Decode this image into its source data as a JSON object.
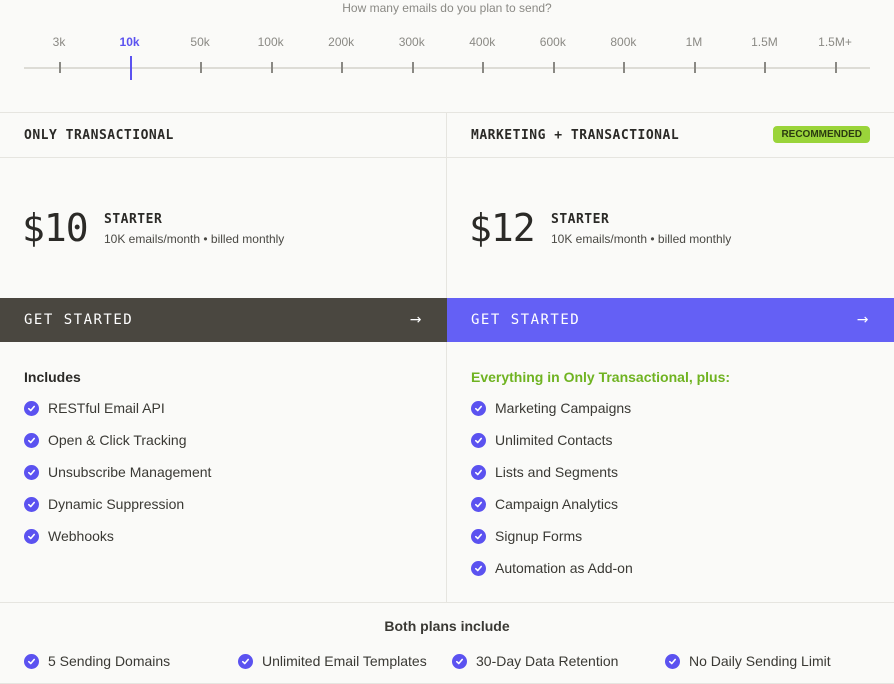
{
  "slider": {
    "question": "How many emails do you plan to send?",
    "ticks": [
      "3k",
      "10k",
      "50k",
      "100k",
      "200k",
      "300k",
      "400k",
      "600k",
      "800k",
      "1M",
      "1.5M",
      "1.5M+"
    ],
    "selected_index": 1,
    "accent": "#5b52f0"
  },
  "plans": {
    "left": {
      "title": "ONLY TRANSACTIONAL",
      "price": "$10",
      "tier": "STARTER",
      "billing": "10K emails/month • billed monthly",
      "cta": "GET STARTED",
      "features_heading": "Includes",
      "features": [
        "RESTful Email API",
        "Open & Click Tracking",
        "Unsubscribe Management",
        "Dynamic Suppression",
        "Webhooks"
      ],
      "cta_color": "#4a4740"
    },
    "right": {
      "title": "MARKETING + TRANSACTIONAL",
      "badge": "RECOMMENDED",
      "price": "$12",
      "tier": "STARTER",
      "billing": "10K emails/month • billed monthly",
      "cta": "GET STARTED",
      "features_heading": "Everything in Only Transactional, plus:",
      "features": [
        "Marketing Campaigns",
        "Unlimited Contacts",
        "Lists and Segments",
        "Campaign Analytics",
        "Signup Forms",
        "Automation as Add-on"
      ],
      "cta_color": "#6460f5",
      "badge_color": "#9ad43a"
    }
  },
  "both": {
    "title": "Both plans include",
    "items": [
      "5 Sending Domains",
      "Unlimited Email Templates",
      "30-Day Data Retention",
      "No Daily Sending Limit"
    ]
  },
  "icons": {
    "check": "check-circle-icon",
    "arrow": "arrow-right-icon"
  }
}
